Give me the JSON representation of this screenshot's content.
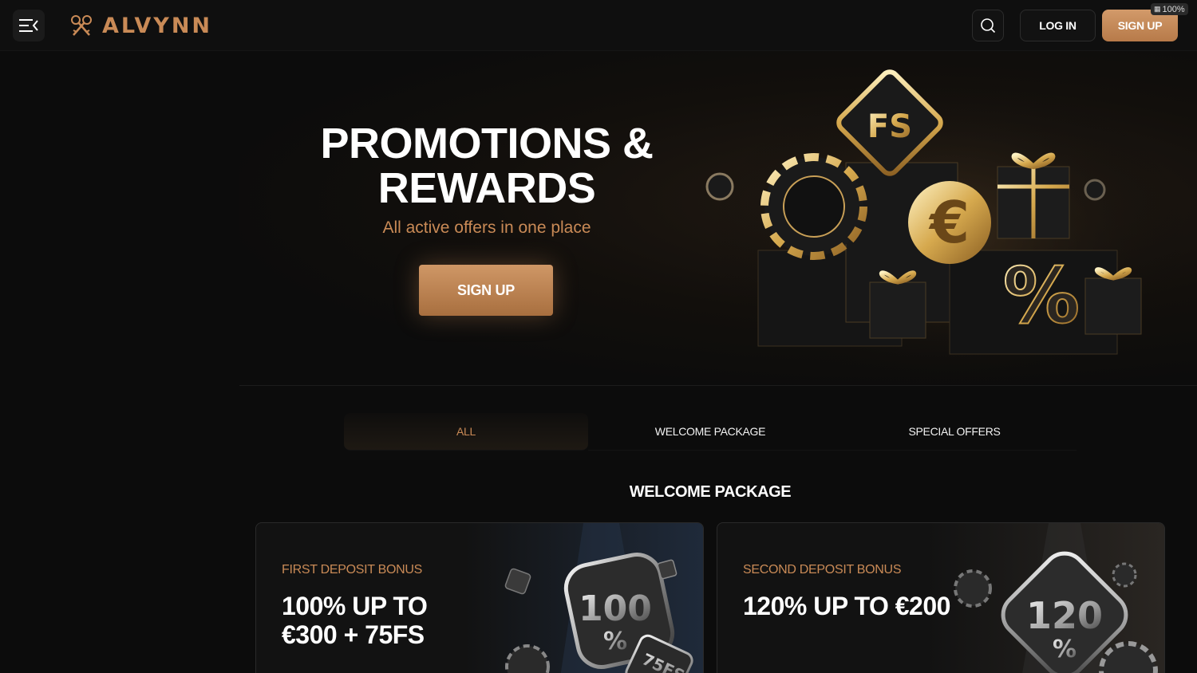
{
  "header": {
    "logo_text": "ALVYNN",
    "login_label": "LOG IN",
    "signup_label": "SIGN UP",
    "zoom_label": "100%"
  },
  "hero": {
    "title_line1": "PROMOTIONS &",
    "title_line2": "REWARDS",
    "subtitle": "All active offers in one place",
    "cta_label": "SIGN UP",
    "art_badge": "FS",
    "art_currency": "€",
    "art_percent": "%"
  },
  "tabs": [
    {
      "label": "ALL",
      "active": true
    },
    {
      "label": "WELCOME PACKAGE",
      "active": false
    },
    {
      "label": "SPECIAL OFFERS",
      "active": false
    }
  ],
  "section": {
    "title": "WELCOME PACKAGE"
  },
  "cards": [
    {
      "label": "FIRST DEPOSIT BONUS",
      "title": "100% UP TO €300 + 75FS",
      "art_number": "100",
      "art_percent": "%",
      "art_chip": "75FS"
    },
    {
      "label": "SECOND DEPOSIT BONUS",
      "title": "120% UP TO €200",
      "art_number": "120",
      "art_percent": "%"
    }
  ],
  "colors": {
    "accent": "#c98a56",
    "background": "#0c0c0c",
    "header": "#0f0f0f"
  },
  "icons": [
    "menu-collapse-icon",
    "logo-keys-icon",
    "search-icon"
  ]
}
